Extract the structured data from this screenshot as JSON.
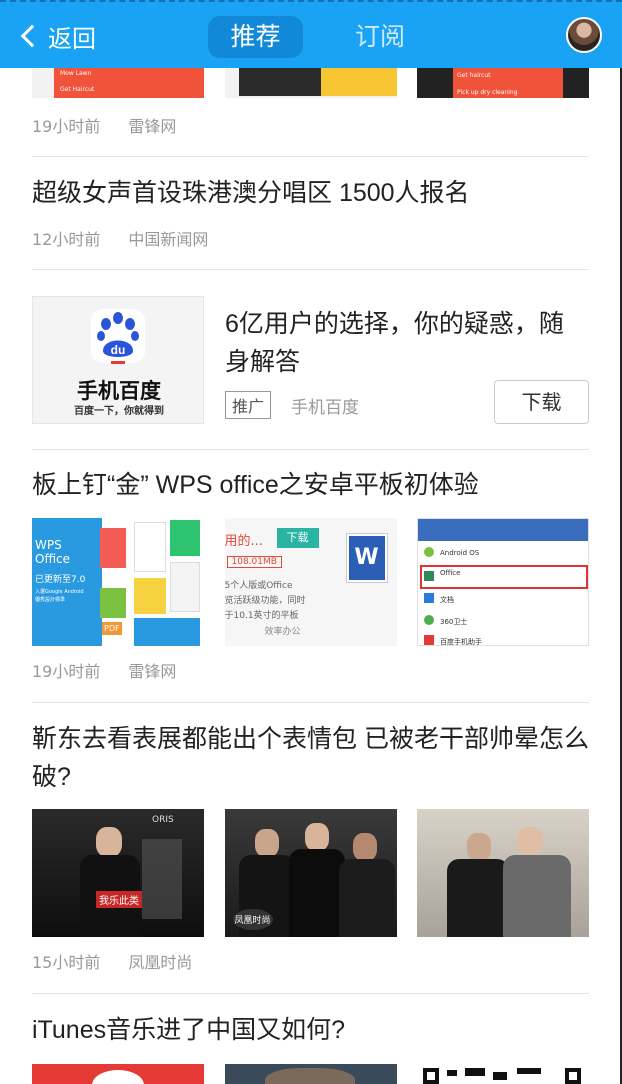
{
  "topbar": {
    "back_label": "返回",
    "tabs": [
      {
        "label": "推荐",
        "active": true
      },
      {
        "label": "订阅",
        "active": false
      }
    ],
    "accent_color": "#1aa3f5"
  },
  "feed": [
    {
      "kind": "partial",
      "thumbs_text": [
        "Mow Lawn",
        "Get Haircut",
        "Get haircut",
        "Pick up dry cleaning"
      ],
      "time": "19小时前",
      "source": "雷锋网"
    },
    {
      "title": "超级女声首设珠港澳分唱区 1500人报名",
      "time": "12小时前",
      "source": "中国新闻网"
    },
    {
      "kind": "ad",
      "logo_name": "手机百度",
      "logo_sub": "百度一下，你就得到",
      "logo_badge": "du",
      "title": "6亿用户的选择，你的疑惑，随身解答",
      "tag": "推广",
      "source": "手机百度",
      "button": "下载"
    },
    {
      "title": "板上钉“金” WPS office之安卓平板初体验",
      "thumb1_text": [
        "WPS",
        "Office",
        "已更新至7.0",
        "入選Google Android",
        "優秀設計標準",
        "PDF"
      ],
      "thumb2_text": [
        "下载",
        "用的...",
        "108.01MB",
        "5个人版或Office",
        "览活跃级功能，同时",
        "于10.1英寸的平板",
        "效率办公"
      ],
      "thumb3_text": [
        "Android OS",
        "Office",
        "文档",
        "360卫士",
        "百度手机助手"
      ],
      "time": "19小时前",
      "source": "雷锋网"
    },
    {
      "title": "靳东去看表展都能出个表情包 已被老干部帅晕怎么破?",
      "thumb_text": [
        "ORIS",
        "我乐此类",
        "凤凰时尚"
      ],
      "time": "15小时前",
      "source": "凤凰时尚"
    },
    {
      "title": "iTunes音乐进了中国又如何?"
    }
  ]
}
